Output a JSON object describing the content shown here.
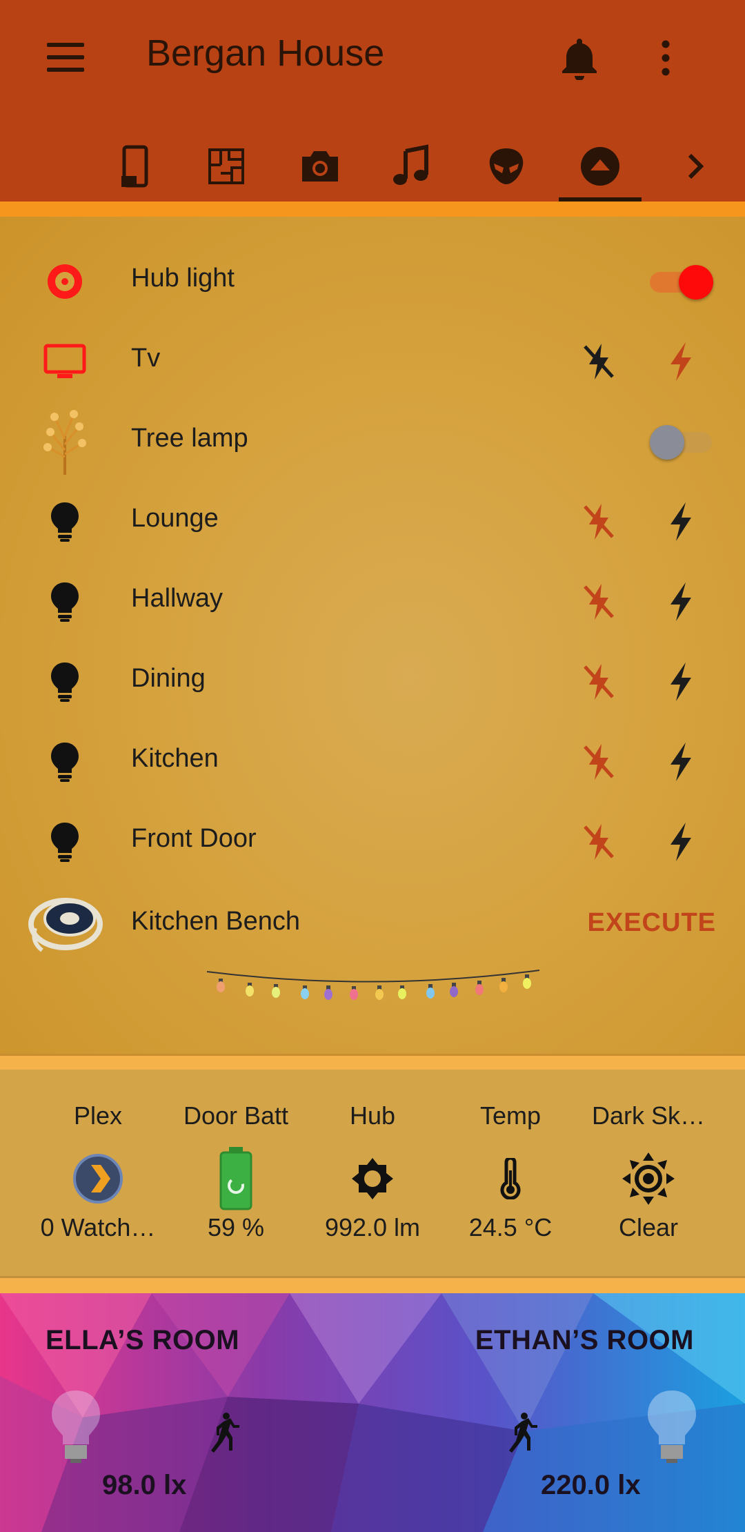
{
  "header": {
    "title": "Bergan House",
    "color": "#b84214"
  },
  "tabs": [
    {
      "icon": "tablet-icon"
    },
    {
      "icon": "floorplan-icon"
    },
    {
      "icon": "camera-icon"
    },
    {
      "icon": "music-icon"
    },
    {
      "icon": "alien-icon"
    },
    {
      "icon": "eject-icon",
      "active": true
    },
    {
      "icon": "chevron-right-icon"
    }
  ],
  "entities": [
    {
      "name": "Hub light",
      "icon": "target-icon",
      "control": "toggle",
      "state": "on"
    },
    {
      "name": "Tv",
      "icon": "tv-icon",
      "control": "buttons"
    },
    {
      "name": "Tree lamp",
      "icon": "tree-lamp-image",
      "control": "toggle",
      "state": "off"
    },
    {
      "name": "Lounge",
      "icon": "bulb-icon",
      "control": "buttons"
    },
    {
      "name": "Hallway",
      "icon": "bulb-icon",
      "control": "buttons"
    },
    {
      "name": "Dining",
      "icon": "bulb-icon",
      "control": "buttons"
    },
    {
      "name": "Kitchen",
      "icon": "bulb-icon",
      "control": "buttons"
    },
    {
      "name": "Front Door",
      "icon": "bulb-icon",
      "control": "buttons"
    },
    {
      "name": "Kitchen Bench",
      "icon": "led-strip-image",
      "control": "execute",
      "action_label": "EXECUTE"
    }
  ],
  "sensors": [
    {
      "label": "Plex",
      "value": "0 Watch…",
      "icon": "plex-icon"
    },
    {
      "label": "Door Batt",
      "value": "59 %",
      "icon": "battery-charging-icon"
    },
    {
      "label": "Hub",
      "value": "992.0 lm",
      "icon": "brightness-icon"
    },
    {
      "label": "Temp",
      "value": "24.5 °C",
      "icon": "thermometer-icon"
    },
    {
      "label": "Dark Sk…",
      "value": "Clear",
      "icon": "sun-icon"
    }
  ],
  "rooms": [
    {
      "title": "ELLA’S ROOM",
      "value": "98.0 lx"
    },
    {
      "title": "ETHAN’S ROOM",
      "value": "220.0 lx"
    }
  ],
  "colors": {
    "accent_red": "#ff1a1a",
    "off_button": "#c1441a",
    "card_bg": "#d5a23e"
  }
}
